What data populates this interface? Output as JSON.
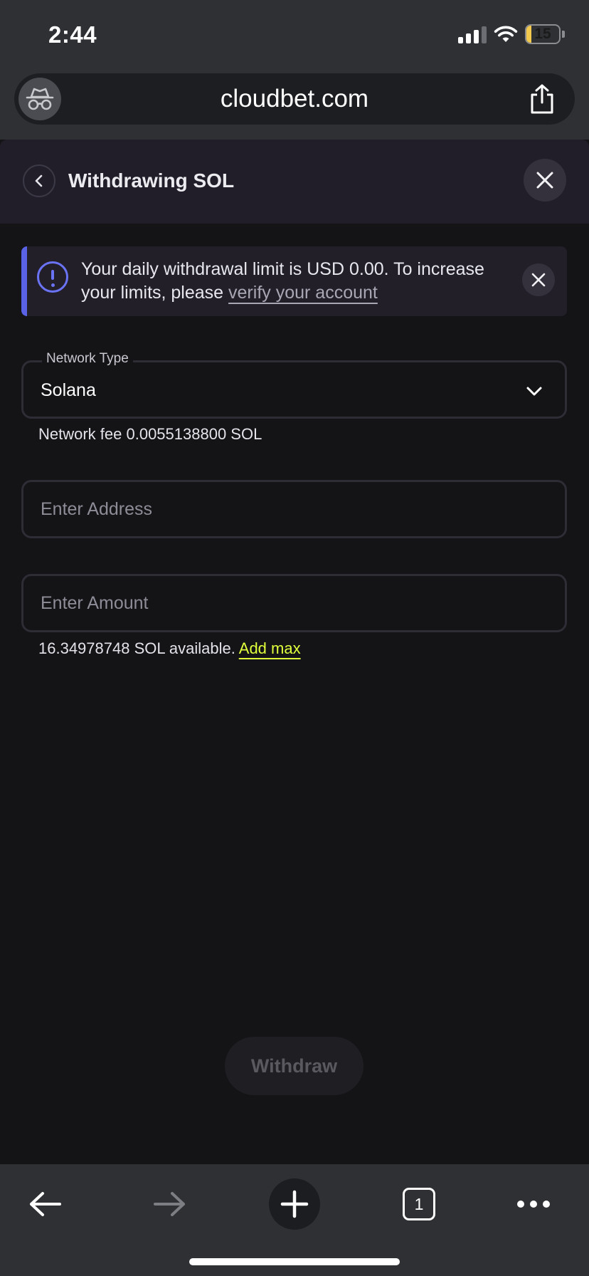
{
  "status_bar": {
    "time": "2:44",
    "battery": "15",
    "battery_level": 0.15
  },
  "browser": {
    "url": "cloudbet.com",
    "tab_count": "1"
  },
  "modal": {
    "title": "Withdrawing SOL"
  },
  "alert": {
    "text_before": "Your daily withdrawal limit is USD 0.00. To increase your limits, please ",
    "link": "verify your account"
  },
  "network": {
    "label": "Network Type",
    "value": "Solana",
    "fee": "Network fee 0.0055138800 SOL"
  },
  "address": {
    "placeholder": "Enter Address"
  },
  "amount": {
    "placeholder": "Enter Amount",
    "available": "16.34978748 SOL available.",
    "add_max": "Add max"
  },
  "withdraw_button": {
    "label": "Withdraw"
  },
  "colors": {
    "accent": "#e2ff3c",
    "info": "#6b73f5",
    "background": "#141316"
  }
}
